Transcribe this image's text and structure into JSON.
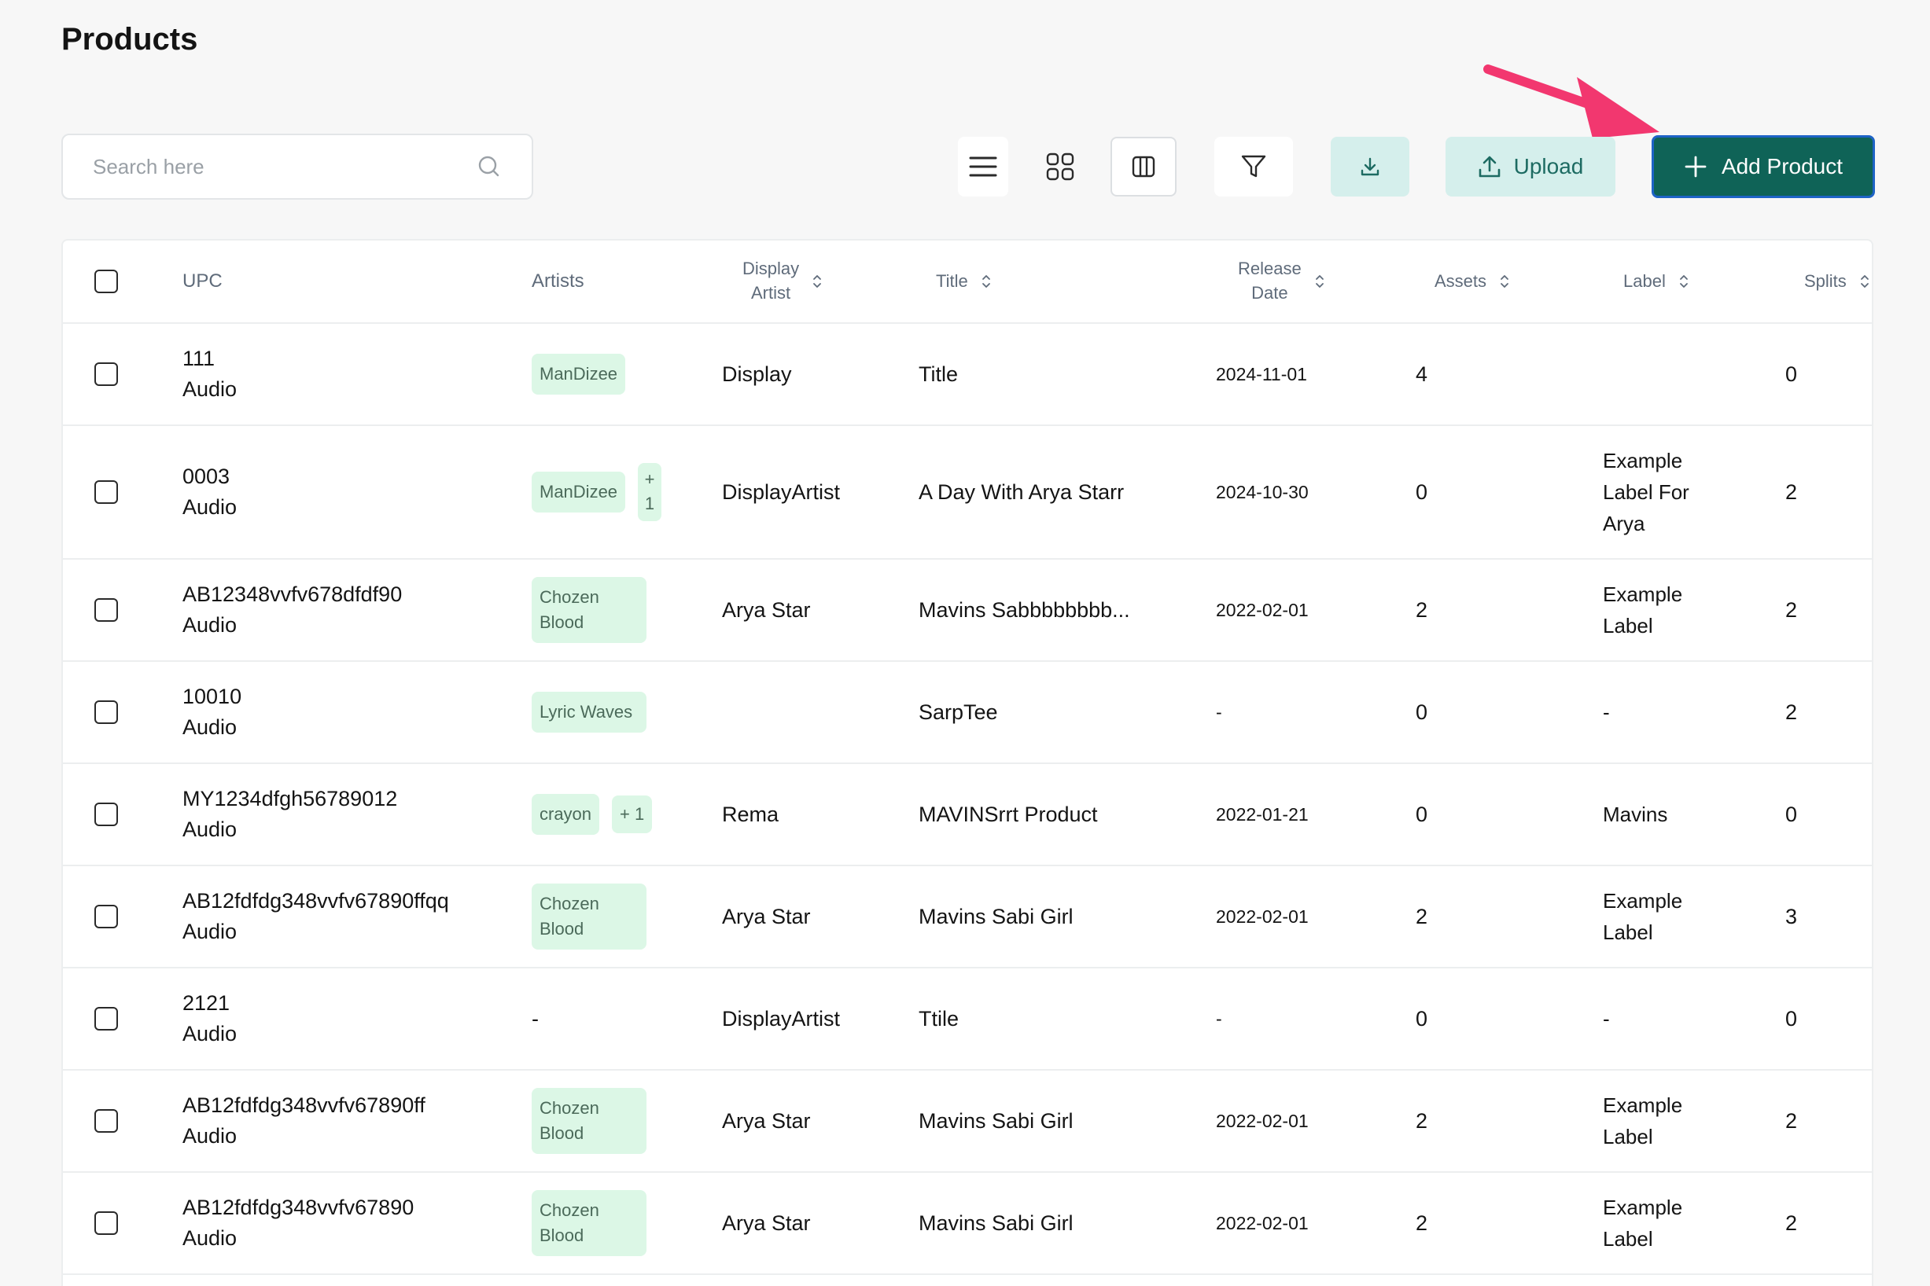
{
  "page": {
    "title": "Products"
  },
  "search": {
    "placeholder": "Search here"
  },
  "toolbar": {
    "upload_label": "Upload",
    "add_label": "Add Product",
    "accent": "#0f6357",
    "soft_accent": "#d5efec"
  },
  "icons": [
    "search-icon",
    "list-view-icon",
    "grid-view-icon",
    "columns-icon",
    "filter-icon",
    "download-icon",
    "upload-icon",
    "plus-icon",
    "pointer-arrow-icon"
  ],
  "table": {
    "headers": {
      "upc": "UPC",
      "artists": "Artists",
      "display_artist_1": "Display",
      "display_artist_2": "Artist",
      "title": "Title",
      "release_date_1": "Release",
      "release_date_2": "Date",
      "assets": "Assets",
      "label": "Label",
      "splits": "Splits"
    },
    "rows": [
      {
        "upc": "111",
        "type": "Audio",
        "artists": [
          "ManDizee"
        ],
        "display_artist": "Display",
        "title": "Title",
        "release_date": "2024-11-01",
        "assets": "4",
        "label": "",
        "splits": "0"
      },
      {
        "upc": "0003",
        "type": "Audio",
        "artists": [
          "ManDizee"
        ],
        "more": "+ 1",
        "display_artist": "DisplayArtist",
        "title": "A Day With Arya Starr",
        "release_date": "2024-10-30",
        "assets": "0",
        "label": "Example Label For Arya",
        "splits": "2"
      },
      {
        "upc": "AB12348vvfv678dfdf90",
        "type": "Audio",
        "artists": [
          "Chozen Blood"
        ],
        "display_artist": "Arya Star",
        "title": "Mavins Sabbbbbbbb...",
        "release_date": "2022-02-01",
        "assets": "2",
        "label": "Example Label",
        "splits": "2"
      },
      {
        "upc": "10010",
        "type": "Audio",
        "artists": [
          "Lyric Waves"
        ],
        "display_artist": "",
        "title": "SarpTee",
        "release_date": "-",
        "assets": "0",
        "label": "-",
        "splits": "2"
      },
      {
        "upc": "MY1234dfgh56789012",
        "type": "Audio",
        "artists": [
          "crayon"
        ],
        "more": "+ 1",
        "display_artist": "Rema",
        "title": "MAVINSrrt Product",
        "release_date": "2022-01-21",
        "assets": "0",
        "label": "Mavins",
        "splits": "0"
      },
      {
        "upc": "AB12fdfdg348vvfv67890ffqq",
        "type": "Audio",
        "artists": [
          "Chozen Blood"
        ],
        "display_artist": "Arya Star",
        "title": "Mavins Sabi Girl",
        "release_date": "2022-02-01",
        "assets": "2",
        "label": "Example Label",
        "splits": "3"
      },
      {
        "upc": "2121",
        "type": "Audio",
        "artists": [],
        "artists_text": "-",
        "display_artist": "DisplayArtist",
        "title": "Ttile",
        "release_date": "-",
        "assets": "0",
        "label": "-",
        "splits": "0"
      },
      {
        "upc": "AB12fdfdg348vvfv67890ff",
        "type": "Audio",
        "artists": [
          "Chozen Blood"
        ],
        "display_artist": "Arya Star",
        "title": "Mavins Sabi Girl",
        "release_date": "2022-02-01",
        "assets": "2",
        "label": "Example Label",
        "splits": "2"
      },
      {
        "upc": "AB12fdfdg348vvfv67890",
        "type": "Audio",
        "artists": [
          "Chozen Blood"
        ],
        "display_artist": "Arya Star",
        "title": "Mavins Sabi Girl",
        "release_date": "2022-02-01",
        "assets": "2",
        "label": "Example Label",
        "splits": "2"
      }
    ]
  }
}
